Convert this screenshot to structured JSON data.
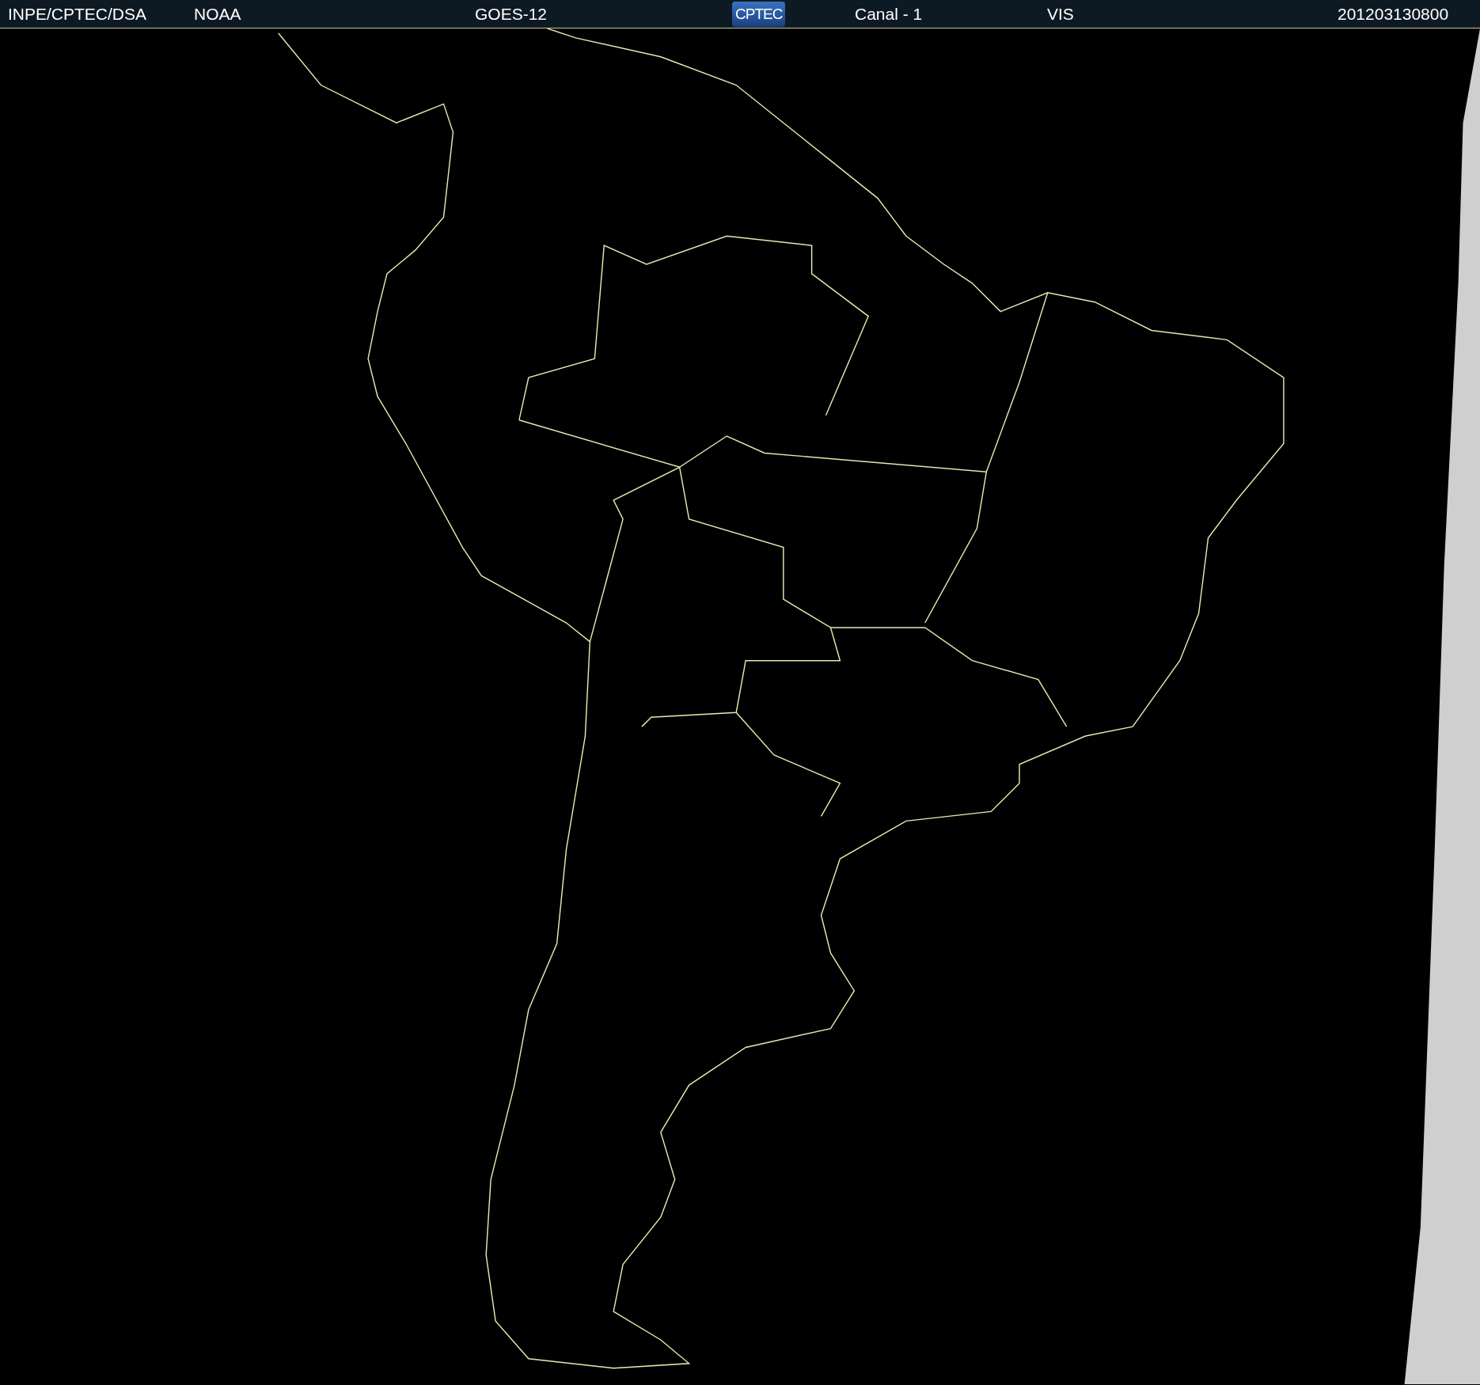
{
  "header": {
    "labels": [
      {
        "kind": "text",
        "text": "INPE/CPTEC/DSA"
      },
      {
        "kind": "text",
        "text": "NOAA"
      },
      {
        "kind": "text",
        "text": "GOES-12"
      },
      {
        "kind": "logo",
        "text": "CPTEC"
      },
      {
        "kind": "text",
        "text": "Canal - 1"
      },
      {
        "kind": "text",
        "text": "VIS"
      },
      {
        "kind": "text",
        "text": "201203130800"
      }
    ]
  }
}
